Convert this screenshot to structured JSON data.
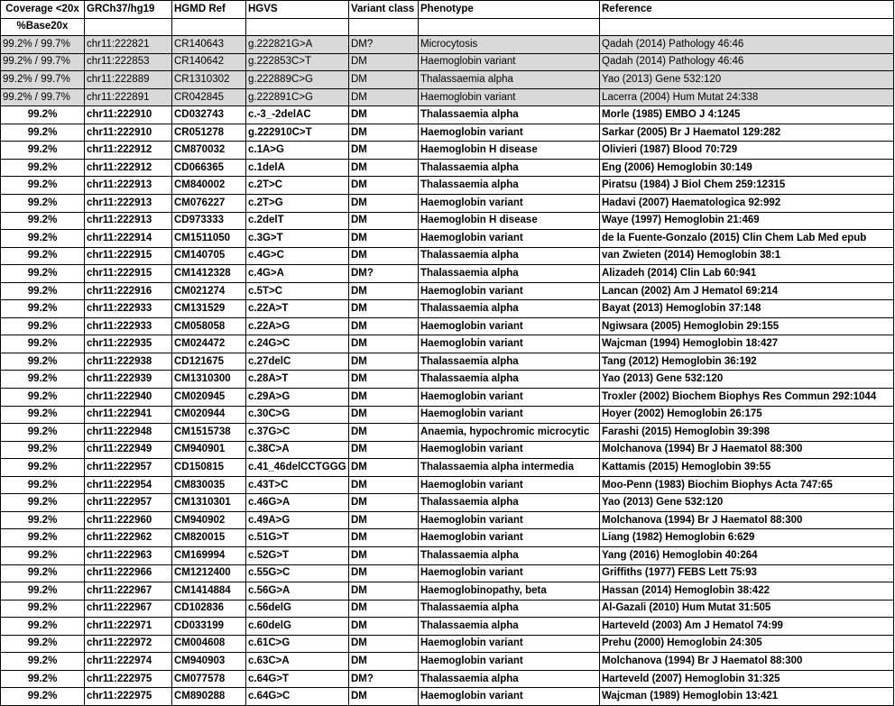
{
  "headers": [
    "Coverage <20x",
    "GRCh37/hg19",
    "HGMD Ref",
    "HGVS",
    "Variant class",
    "Phenotype",
    "Reference"
  ],
  "subheader": "%Base20x",
  "rows": [
    {
      "highlight": true,
      "cells": [
        "99.2% / 99.7%",
        "chr11:222821",
        "CR140643",
        "g.222821G>A",
        "DM?",
        "Microcytosis",
        "Qadah (2014) Pathology 46:46"
      ]
    },
    {
      "highlight": true,
      "cells": [
        "99.2% / 99.7%",
        "chr11:222853",
        "CR140642",
        "g.222853C>T",
        "DM",
        "Haemoglobin variant",
        "Qadah (2014) Pathology 46:46"
      ]
    },
    {
      "highlight": true,
      "cells": [
        "99.2% / 99.7%",
        "chr11:222889",
        "CR1310302",
        "g.222889C>G",
        "DM",
        "Thalassaemia alpha",
        "Yao (2013) Gene 532:120"
      ]
    },
    {
      "highlight": true,
      "cells": [
        "99.2% / 99.7%",
        "chr11:222891",
        "CR042845",
        "g.222891C>G",
        "DM",
        "Haemoglobin variant",
        "Lacerra (2004) Hum Mutat 24:338"
      ]
    },
    {
      "highlight": false,
      "cells": [
        "99.2%",
        "chr11:222910",
        "CD032743",
        "c.-3_-2delAC",
        "DM",
        "Thalassaemia alpha",
        "Morle (1985) EMBO J 4:1245"
      ]
    },
    {
      "highlight": false,
      "cells": [
        "99.2%",
        "chr11:222910",
        "CR051278",
        "g.222910C>T",
        "DM",
        "Haemoglobin variant",
        "Sarkar (2005) Br J Haematol 129:282"
      ]
    },
    {
      "highlight": false,
      "cells": [
        "99.2%",
        "chr11:222912",
        "CM870032",
        "c.1A>G",
        "DM",
        "Haemoglobin H disease",
        "Olivieri (1987) Blood 70:729"
      ]
    },
    {
      "highlight": false,
      "cells": [
        "99.2%",
        "chr11:222912",
        "CD066365",
        "c.1delA",
        "DM",
        "Thalassaemia alpha",
        "Eng (2006) Hemoglobin 30:149"
      ]
    },
    {
      "highlight": false,
      "cells": [
        "99.2%",
        "chr11:222913",
        "CM840002",
        "c.2T>C",
        "DM",
        "Thalassaemia alpha",
        "Piratsu (1984) J Biol Chem 259:12315"
      ]
    },
    {
      "highlight": false,
      "cells": [
        "99.2%",
        "chr11:222913",
        "CM076227",
        "c.2T>G",
        "DM",
        "Haemoglobin variant",
        "Hadavi (2007) Haematologica 92:992"
      ]
    },
    {
      "highlight": false,
      "cells": [
        "99.2%",
        "chr11:222913",
        "CD973333",
        "c.2delT",
        "DM",
        "Haemoglobin H disease",
        "Waye (1997) Hemoglobin 21:469"
      ]
    },
    {
      "highlight": false,
      "cells": [
        "99.2%",
        "chr11:222914",
        "CM1511050",
        "c.3G>T",
        "DM",
        "Haemoglobin variant",
        "de la Fuente-Gonzalo (2015) Clin Chem Lab Med epub"
      ]
    },
    {
      "highlight": false,
      "cells": [
        "99.2%",
        "chr11:222915",
        "CM140705",
        "c.4G>C",
        "DM",
        "Thalassaemia alpha",
        "van Zwieten (2014) Hemoglobin 38:1"
      ]
    },
    {
      "highlight": false,
      "cells": [
        "99.2%",
        "chr11:222915",
        "CM1412328",
        "c.4G>A",
        "DM?",
        "Thalassaemia alpha",
        "Alizadeh (2014) Clin Lab 60:941"
      ]
    },
    {
      "highlight": false,
      "cells": [
        "99.2%",
        "chr11:222916",
        "CM021274",
        "c.5T>C",
        "DM",
        "Haemoglobin variant",
        "Lancan (2002) Am J Hematol 69:214"
      ]
    },
    {
      "highlight": false,
      "cells": [
        "99.2%",
        "chr11:222933",
        "CM131529",
        "c.22A>T",
        "DM",
        "Thalassaemia alpha",
        "Bayat (2013) Hemoglobin 37:148"
      ]
    },
    {
      "highlight": false,
      "cells": [
        "99.2%",
        "chr11:222933",
        "CM058058",
        "c.22A>G",
        "DM",
        "Haemoglobin variant",
        "Ngiwsara (2005) Hemoglobin 29:155"
      ]
    },
    {
      "highlight": false,
      "cells": [
        "99.2%",
        "chr11:222935",
        "CM024472",
        "c.24G>C",
        "DM",
        "Haemoglobin variant",
        "Wajcman (1994) Hemoglobin 18:427"
      ]
    },
    {
      "highlight": false,
      "cells": [
        "99.2%",
        "chr11:222938",
        "CD121675",
        "c.27delC",
        "DM",
        "Thalassaemia alpha",
        "Tang (2012) Hemoglobin 36:192"
      ]
    },
    {
      "highlight": false,
      "cells": [
        "99.2%",
        "chr11:222939",
        "CM1310300",
        "c.28A>T",
        "DM",
        "Thalassaemia alpha",
        "Yao (2013) Gene 532:120"
      ]
    },
    {
      "highlight": false,
      "cells": [
        "99.2%",
        "chr11:222940",
        "CM020945",
        "c.29A>G",
        "DM",
        "Haemoglobin variant",
        "Troxler (2002) Biochem Biophys Res Commun 292:1044"
      ]
    },
    {
      "highlight": false,
      "cells": [
        "99.2%",
        "chr11:222941",
        "CM020944",
        "c.30C>G",
        "DM",
        "Haemoglobin variant",
        "Hoyer (2002) Hemoglobin 26:175"
      ]
    },
    {
      "highlight": false,
      "cells": [
        "99.2%",
        "chr11:222948",
        "CM1515738",
        "c.37G>C",
        "DM",
        "Anaemia, hypochromic microcytic",
        "Farashi (2015) Hemoglobin 39:398"
      ]
    },
    {
      "highlight": false,
      "cells": [
        "99.2%",
        "chr11:222949",
        "CM940901",
        "c.38C>A",
        "DM",
        "Haemoglobin variant",
        "Molchanova (1994) Br J Haematol 88:300"
      ]
    },
    {
      "highlight": false,
      "cells": [
        "99.2%",
        "chr11:222957",
        "CD150815",
        "c.41_46delCCTGGG",
        "DM",
        "Thalassaemia alpha intermedia",
        "Kattamis (2015) Hemoglobin 39:55"
      ]
    },
    {
      "highlight": false,
      "cells": [
        "99.2%",
        "chr11:222954",
        "CM830035",
        "c.43T>C",
        "DM",
        "Haemoglobin variant",
        "Moo-Penn (1983) Biochim Biophys Acta 747:65"
      ]
    },
    {
      "highlight": false,
      "cells": [
        "99.2%",
        "chr11:222957",
        "CM1310301",
        "c.46G>A",
        "DM",
        "Thalassaemia alpha",
        "Yao (2013) Gene 532:120"
      ]
    },
    {
      "highlight": false,
      "cells": [
        "99.2%",
        "chr11:222960",
        "CM940902",
        "c.49A>G",
        "DM",
        "Haemoglobin variant",
        "Molchanova (1994) Br J Haematol 88:300"
      ]
    },
    {
      "highlight": false,
      "cells": [
        "99.2%",
        "chr11:222962",
        "CM820015",
        "c.51G>T",
        "DM",
        "Haemoglobin variant",
        "Liang (1982) Hemoglobin 6:629"
      ]
    },
    {
      "highlight": false,
      "cells": [
        "99.2%",
        "chr11:222963",
        "CM169994",
        "c.52G>T",
        "DM",
        "Thalassaemia alpha",
        "Yang (2016) Hemoglobin 40:264"
      ]
    },
    {
      "highlight": false,
      "cells": [
        "99.2%",
        "chr11:222966",
        "CM1212400",
        "c.55G>C",
        "DM",
        "Haemoglobin variant",
        "Griffiths (1977) FEBS Lett 75:93"
      ]
    },
    {
      "highlight": false,
      "cells": [
        "99.2%",
        "chr11:222967",
        "CM1414884",
        "c.56G>A",
        "DM",
        "Haemoglobinopathy, beta",
        "Hassan (2014) Hemoglobin 38:422"
      ]
    },
    {
      "highlight": false,
      "cells": [
        "99.2%",
        "chr11:222967",
        "CD102836",
        "c.56delG",
        "DM",
        "Thalassaemia alpha",
        "Al-Gazali (2010) Hum Mutat 31:505"
      ]
    },
    {
      "highlight": false,
      "cells": [
        "99.2%",
        "chr11:222971",
        "CD033199",
        "c.60delG",
        "DM",
        "Thalassaemia alpha",
        "Harteveld (2003) Am J Hematol 74:99"
      ]
    },
    {
      "highlight": false,
      "cells": [
        "99.2%",
        "chr11:222972",
        "CM004608",
        "c.61C>G",
        "DM",
        "Haemoglobin variant",
        "Prehu (2000) Hemoglobin 24:305"
      ]
    },
    {
      "highlight": false,
      "cells": [
        "99.2%",
        "chr11:222974",
        "CM940903",
        "c.63C>A",
        "DM",
        "Haemoglobin variant",
        "Molchanova (1994) Br J Haematol 88:300"
      ]
    },
    {
      "highlight": false,
      "cells": [
        "99.2%",
        "chr11:222975",
        "CM077578",
        "c.64G>T",
        "DM?",
        "Thalassaemia alpha",
        "Harteveld (2007) Hemoglobin 31:325"
      ]
    },
    {
      "highlight": false,
      "cells": [
        "99.2%",
        "chr11:222975",
        "CM890288",
        "c.64G>C",
        "DM",
        "Haemoglobin variant",
        "Wajcman (1989) Hemoglobin 13:421"
      ]
    }
  ]
}
